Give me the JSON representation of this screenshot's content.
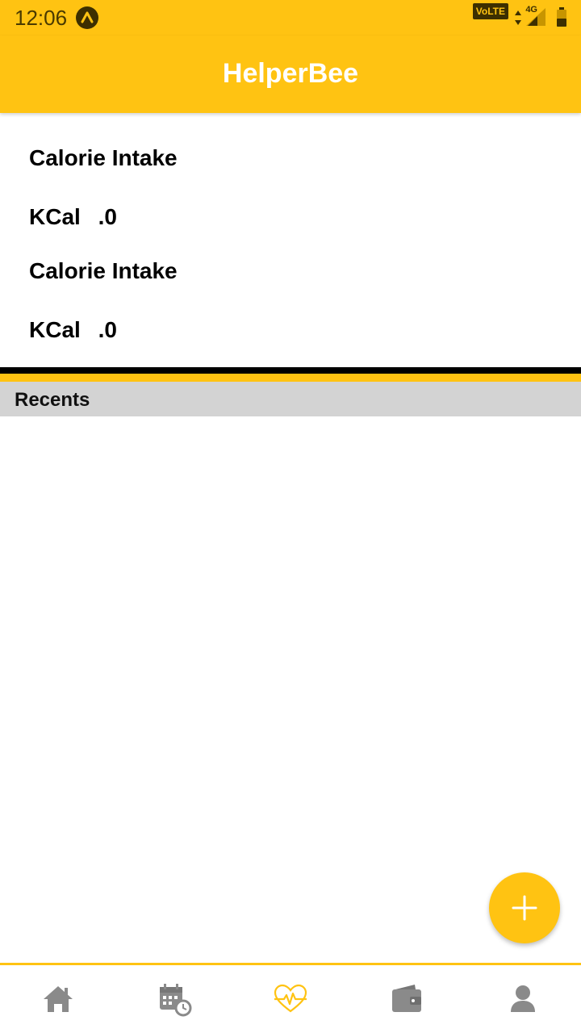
{
  "status_bar": {
    "time": "12:06",
    "volte_label": "VoLTE",
    "network_label": "4G",
    "icons": [
      "app-notification-icon",
      "volte-icon",
      "data-arrows-icon",
      "signal-icon",
      "battery-icon"
    ]
  },
  "app_bar": {
    "title": "HelperBee"
  },
  "stats": [
    {
      "title": "Calorie Intake",
      "unit": "KCal",
      "value": ".0"
    },
    {
      "title": "Calorie Intake",
      "unit": "KCal",
      "value": ".0"
    }
  ],
  "recents": {
    "header": "Recents",
    "items": []
  },
  "fab": {
    "icon": "plus-icon"
  },
  "bottom_nav": {
    "items": [
      {
        "name": "home",
        "icon": "home-icon",
        "active": false
      },
      {
        "name": "schedule",
        "icon": "calendar-clock-icon",
        "active": false
      },
      {
        "name": "health",
        "icon": "heart-pulse-icon",
        "active": true
      },
      {
        "name": "wallet",
        "icon": "wallet-icon",
        "active": false
      },
      {
        "name": "profile",
        "icon": "person-icon",
        "active": false
      }
    ]
  },
  "colors": {
    "primary": "#FFC312",
    "nav_inactive": "#8a8a8a",
    "section_header_bg": "#D3D3D3",
    "divider": "#000000"
  }
}
